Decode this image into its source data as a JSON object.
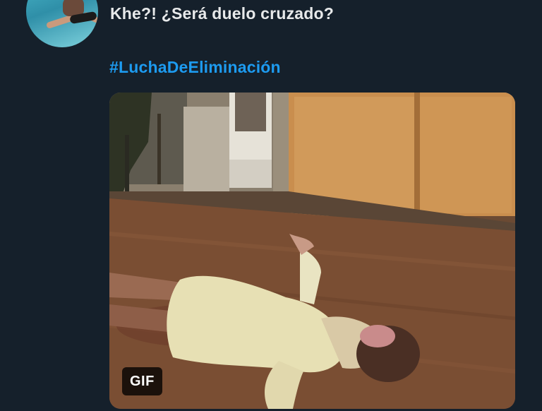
{
  "tweet": {
    "text": "Khe?! ¿Será duelo cruzado?",
    "hashtag": "#LuchaDeEliminación"
  },
  "media": {
    "badge_label": "GIF"
  },
  "colors": {
    "background": "#15202b",
    "text": "#e7e9ea",
    "link": "#1d9bf0"
  },
  "icons": {
    "avatar": "user-avatar-photo"
  }
}
